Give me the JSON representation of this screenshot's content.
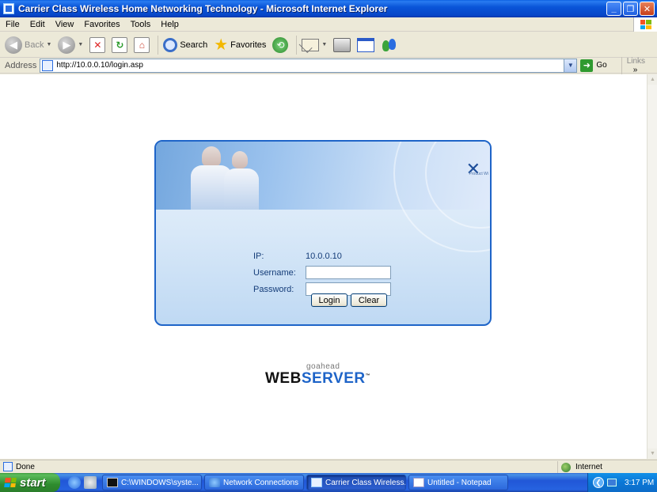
{
  "window": {
    "title": "Carrier Class Wireless Home Networking Technology - Microsoft Internet Explorer",
    "minimize": "_",
    "restore": "❐",
    "close": "✕"
  },
  "menu": {
    "items": [
      "File",
      "Edit",
      "View",
      "Favorites",
      "Tools",
      "Help"
    ]
  },
  "toolbar": {
    "back_label": "Back",
    "search_label": "Search",
    "favorites_label": "Favorites"
  },
  "address": {
    "label": "Address",
    "url": "http://10.0.0.10/login.asp",
    "go_label": "Go",
    "links_label": "Links"
  },
  "login": {
    "ip_label": "IP:",
    "ip_value": "10.0.0.10",
    "username_label": "Username:",
    "username_value": "",
    "password_label": "Password:",
    "password_value": "",
    "login_button": "Login",
    "clear_button": "Clear",
    "brand_mark": "✕",
    "brand_sub": "Product Wi"
  },
  "logo": {
    "small": "goahead",
    "web": "WEB",
    "server": "SERVER",
    "tm": "™"
  },
  "status": {
    "text": "Done",
    "zone": "Internet"
  },
  "taskbar": {
    "start_label": "start",
    "tasks": [
      "C:\\WINDOWS\\syste...",
      "Network Connections",
      "Carrier Class Wireless...",
      "Untitled - Notepad"
    ],
    "clock": "3:17 PM"
  },
  "colors": {
    "accent": "#1e64c8",
    "titlebar": "#0a55d8"
  }
}
